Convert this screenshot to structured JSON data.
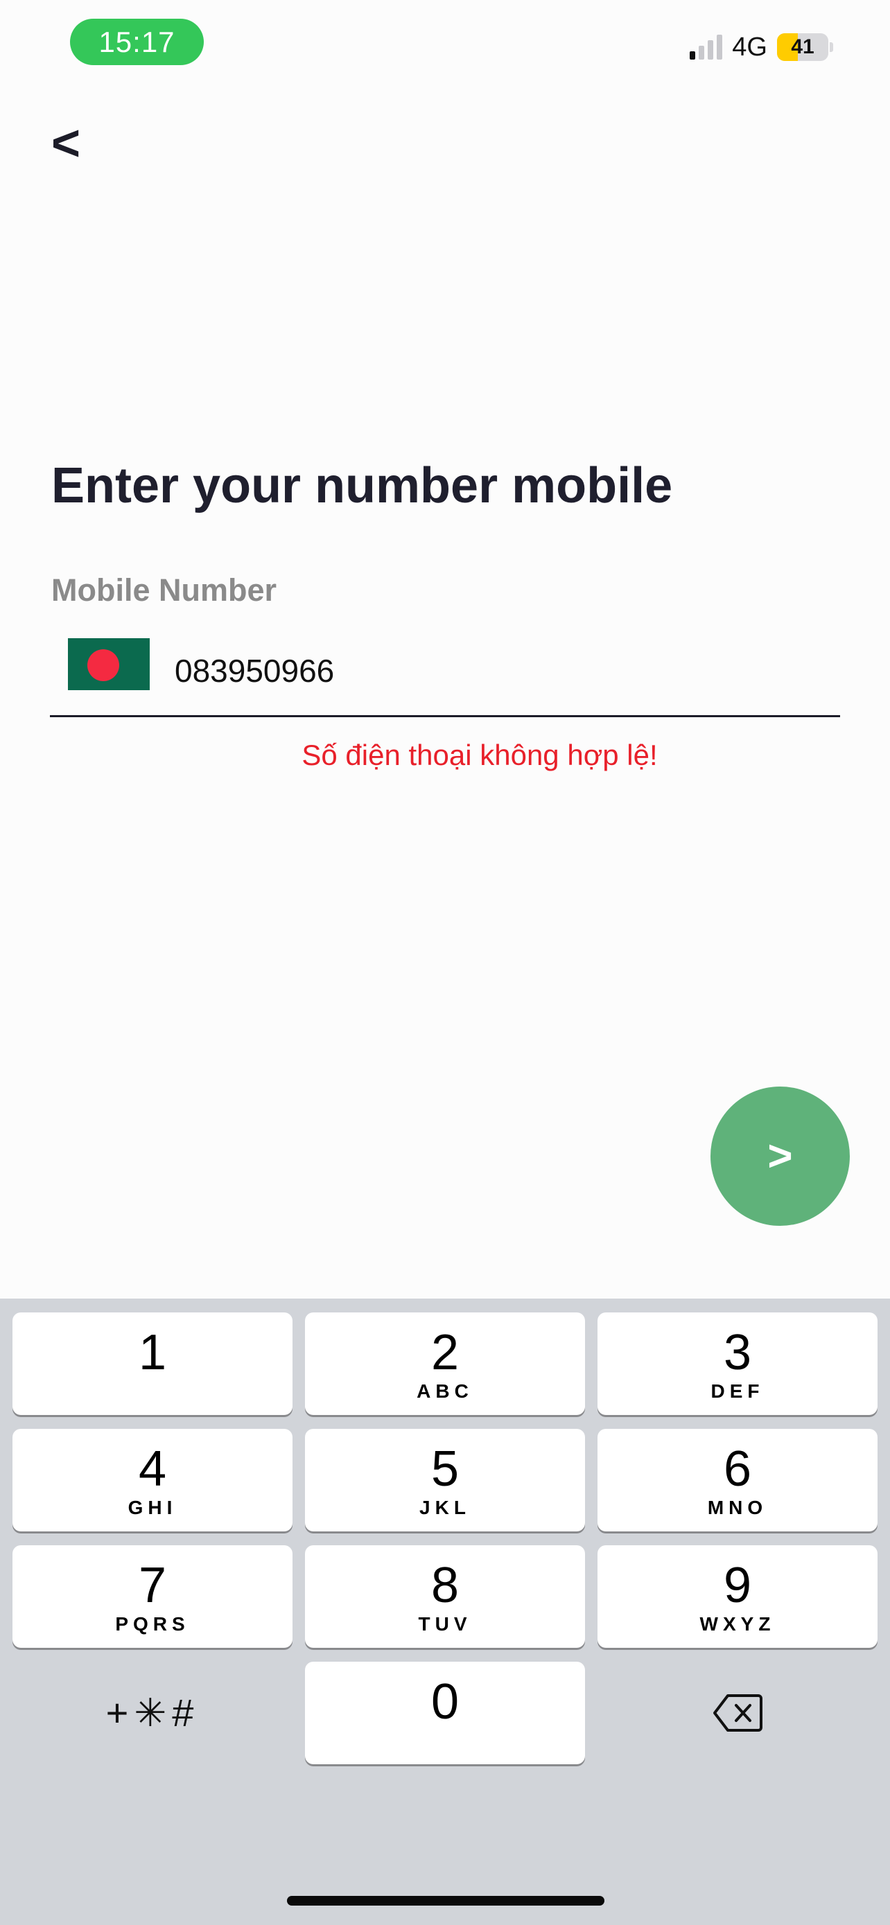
{
  "status_bar": {
    "time": "15:17",
    "network": "4G",
    "battery": "41",
    "battery_level": 0.41
  },
  "nav": {
    "back_label": "<"
  },
  "page": {
    "title": "Enter your number mobile",
    "field_label": "Mobile Number",
    "phone_value": "083950966",
    "country_flag": "bangladesh-flag-icon",
    "error_message": "Số điện thoại không hợp lệ!",
    "next_label": ">"
  },
  "colors": {
    "accent_green": "#5fb27a",
    "error_red": "#e8202a",
    "time_pill": "#34c759"
  },
  "keyboard": {
    "keys": [
      {
        "digit": "1",
        "letters": ""
      },
      {
        "digit": "2",
        "letters": "ABC"
      },
      {
        "digit": "3",
        "letters": "DEF"
      },
      {
        "digit": "4",
        "letters": "GHI"
      },
      {
        "digit": "5",
        "letters": "JKL"
      },
      {
        "digit": "6",
        "letters": "MNO"
      },
      {
        "digit": "7",
        "letters": "PQRS"
      },
      {
        "digit": "8",
        "letters": "TUV"
      },
      {
        "digit": "9",
        "letters": "WXYZ"
      },
      {
        "digit": "0",
        "letters": ""
      }
    ],
    "symbols_label": "+✳#",
    "delete_icon": "backspace-icon"
  }
}
